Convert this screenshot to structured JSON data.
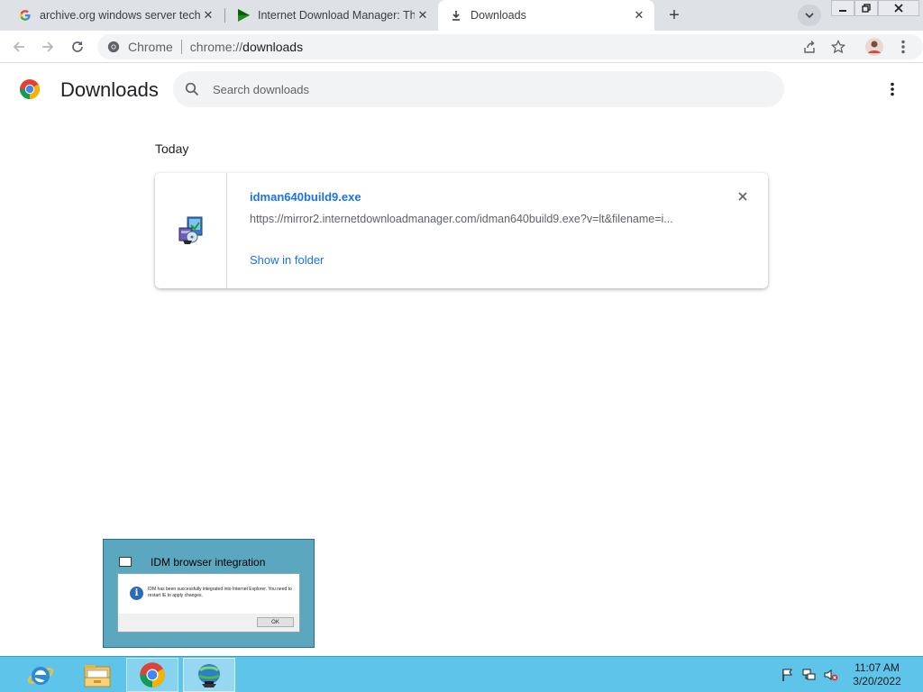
{
  "tabs": [
    {
      "title": "archive.org windows server techn",
      "favicon": "google-g-icon"
    },
    {
      "title": "Internet Download Manager: The",
      "favicon": "idm-play-icon"
    },
    {
      "title": "Downloads",
      "favicon": "download-icon",
      "active": true
    }
  ],
  "omnibox": {
    "chip": "Chrome",
    "url_scheme": "chrome://",
    "url_path": "downloads"
  },
  "downloads_page": {
    "title": "Downloads",
    "search_placeholder": "Search downloads",
    "date_heading": "Today",
    "items": [
      {
        "file_name": "idman640build9.exe",
        "url": "https://mirror2.internetdownloadmanager.com/idman640build9.exe?v=lt&filename=i...",
        "action": "Show in folder"
      }
    ]
  },
  "idm_popup": {
    "title": "IDM browser integration",
    "message": "IDM has been successfully integrated into Internet Explorer. You need to restart IE to apply changes.",
    "ok_label": "OK"
  },
  "taskbar": {
    "apps": [
      "internet-explorer-icon",
      "file-explorer-icon",
      "chrome-icon",
      "idm-icon"
    ],
    "time": "11:07 AM",
    "date": "3/20/2022"
  },
  "colors": {
    "accent": "#1a73e8",
    "taskbar": "#5ec4ea",
    "tab_strip": "#dee1e6"
  }
}
